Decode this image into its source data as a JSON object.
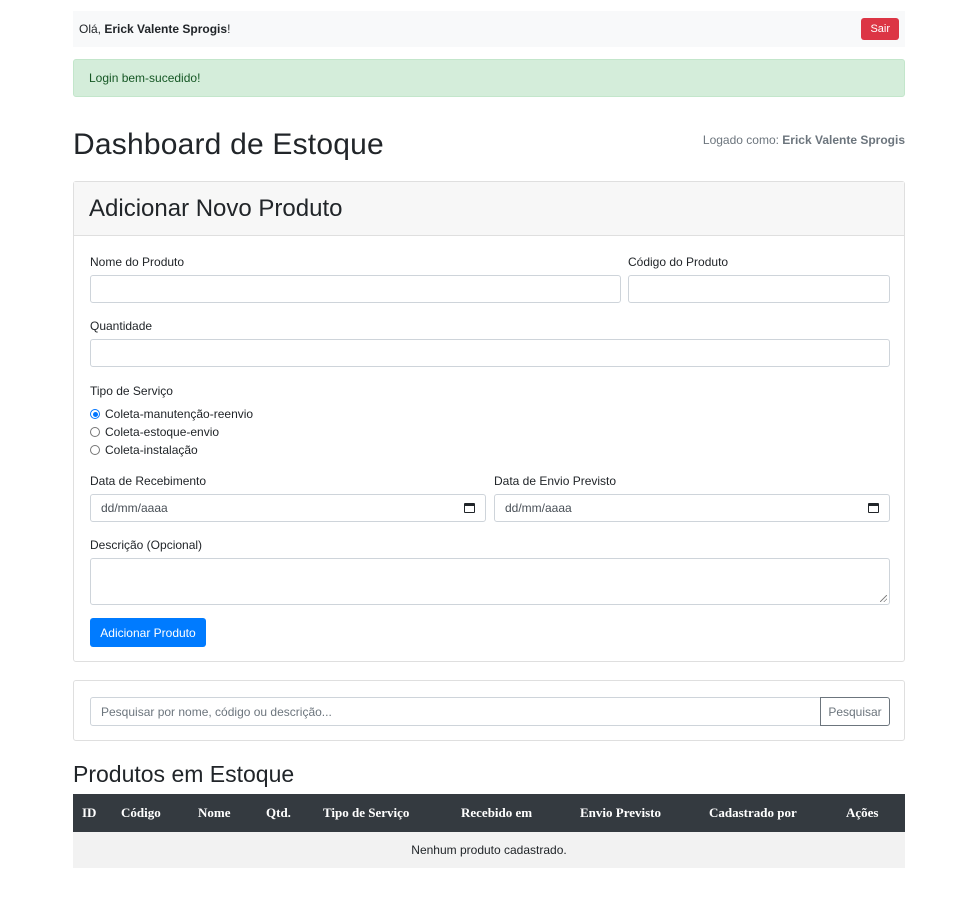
{
  "topbar": {
    "greeting_prefix": "Olá, ",
    "user_name": "Erick Valente Sprogis",
    "greeting_suffix": "!",
    "logout_label": "Sair"
  },
  "alert": {
    "message": "Login bem-sucedido!"
  },
  "header": {
    "title": "Dashboard de Estoque",
    "logged_prefix": "Logado como: ",
    "logged_user": "Erick Valente Sprogis"
  },
  "form": {
    "title": "Adicionar Novo Produto",
    "product_name_label": "Nome do Produto",
    "product_name_value": "",
    "product_code_label": "Código do Produto",
    "product_code_value": "",
    "quantity_label": "Quantidade",
    "quantity_value": "",
    "service_type_label": "Tipo de Serviço",
    "service_options": [
      "Coleta-manutenção-reenvio",
      "Coleta-estoque-envio",
      "Coleta-instalação"
    ],
    "service_selected": "Coleta-manutenção-reenvio",
    "received_date_label": "Data de Recebimento",
    "received_date_placeholder": "dd/mm/aaaa",
    "ship_date_label": "Data de Envio Previsto",
    "ship_date_placeholder": "dd/mm/aaaa",
    "description_label": "Descrição (Opcional)",
    "description_value": "",
    "submit_label": "Adicionar Produto",
    "calendar_icon": "calendar-icon"
  },
  "search": {
    "placeholder": "Pesquisar por nome, código ou descrição...",
    "button_label": "Pesquisar"
  },
  "products": {
    "title": "Produtos em Estoque",
    "columns": [
      "ID",
      "Código",
      "Nome",
      "Qtd.",
      "Tipo de Serviço",
      "Recebido em",
      "Envio Previsto",
      "Cadastrado por",
      "Ações"
    ],
    "rows": [],
    "empty_message": "Nenhum produto cadastrado."
  },
  "colors": {
    "primary": "#007bff",
    "danger": "#dc3545",
    "success_bg": "#d4edda",
    "success_text": "#155724",
    "table_header": "#343a40"
  }
}
